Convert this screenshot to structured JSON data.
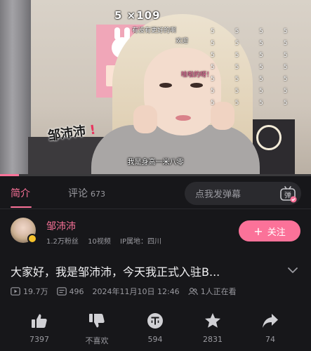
{
  "video": {
    "danmu_counter": "5 ×109",
    "danmu_lines": [
      "有没有更好的啊",
      "欢迎",
      "哇啦的呀！"
    ],
    "fives": "5 5 5 5 5 5 5 5 5 5 5 5 5 5 5 5 5 5 5 5 5 5 5 5 5 5 5 5",
    "nameplate": "邹沛沛",
    "nameplate_mark": "!",
    "subtitle": "我是身高一米八零",
    "progress": 0.06
  },
  "tabs": {
    "intro_label": "简介",
    "comment_label": "评论",
    "comment_count": "673",
    "danmu_placeholder": "点我发弹幕",
    "danmu_toggle_label": "弹"
  },
  "uploader": {
    "name": "邹沛沛",
    "fans": "1.2万粉丝",
    "videos": "10视频",
    "ip": "IP属地：四川",
    "follow_label": "关注",
    "follow_plus": "+"
  },
  "video_info": {
    "title": "大家好，我是邹沛沛，今天我正式入驻B...",
    "views": "19.7万",
    "danmu_count": "496",
    "datetime": "2024年11月10日 12:46",
    "watching": "1人正在看"
  },
  "actions": {
    "like": "7397",
    "dislike": "不喜欢",
    "coin": "594",
    "favorite": "2831",
    "share": "74"
  },
  "colors": {
    "accent": "#fb7299",
    "background": "#17171a",
    "muted_text": "#9a9aa0"
  }
}
